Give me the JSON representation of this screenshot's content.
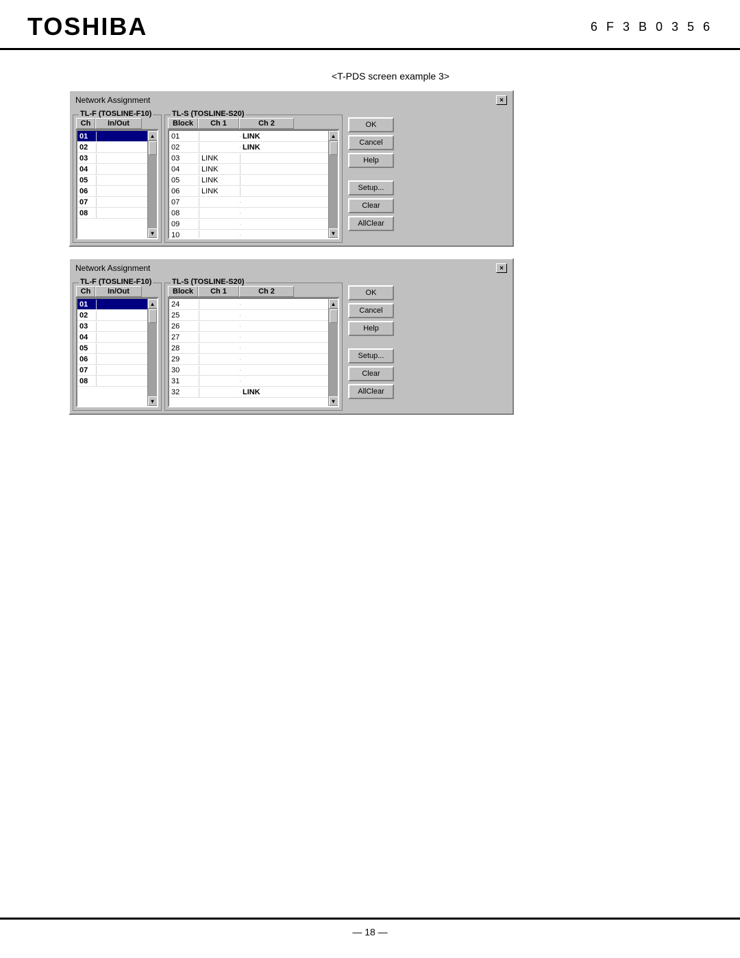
{
  "header": {
    "logo": "TOSHIBA",
    "doc_number": "6 F 3 B 0 3 5 6"
  },
  "screen_label": "<T-PDS screen example 3>",
  "dialog1": {
    "title": "Network Assignment",
    "close_label": "×",
    "tlf_group_label": "TL-F (TOSLINE-F10)",
    "tls_group_label": "TL-S (TOSLINE-S20)",
    "tlf_columns": [
      "Ch",
      "In/Out"
    ],
    "tls_columns": [
      "Block",
      "Ch 1",
      "Ch 2"
    ],
    "tlf_rows": [
      {
        "ch": "01",
        "inout": "",
        "selected": true
      },
      {
        "ch": "02",
        "inout": ""
      },
      {
        "ch": "03",
        "inout": ""
      },
      {
        "ch": "04",
        "inout": ""
      },
      {
        "ch": "05",
        "inout": ""
      },
      {
        "ch": "06",
        "inout": ""
      },
      {
        "ch": "07",
        "inout": ""
      },
      {
        "ch": "08",
        "inout": ""
      }
    ],
    "tls_rows": [
      {
        "block": "01",
        "ch1": "",
        "ch2": "LINK"
      },
      {
        "block": "02",
        "ch1": "",
        "ch2": "LINK"
      },
      {
        "block": "03",
        "ch1": "LINK",
        "ch2": ""
      },
      {
        "block": "04",
        "ch1": "LINK",
        "ch2": ""
      },
      {
        "block": "05",
        "ch1": "LINK",
        "ch2": ""
      },
      {
        "block": "06",
        "ch1": "LINK",
        "ch2": ""
      },
      {
        "block": "07",
        "ch1": "",
        "ch2": ""
      },
      {
        "block": "08",
        "ch1": "",
        "ch2": ""
      },
      {
        "block": "09",
        "ch1": "",
        "ch2": ""
      },
      {
        "block": "10",
        "ch1": "",
        "ch2": ""
      }
    ],
    "buttons": [
      {
        "label": "OK",
        "name": "ok-button"
      },
      {
        "label": "Cancel",
        "name": "cancel-button"
      },
      {
        "label": "Help",
        "name": "help-button"
      },
      {
        "label": "Setup...",
        "name": "setup-button"
      },
      {
        "label": "Clear",
        "name": "clear-button"
      },
      {
        "label": "AllClear",
        "name": "allclear-button"
      }
    ]
  },
  "dialog2": {
    "title": "Network Assignment",
    "close_label": "×",
    "tlf_group_label": "TL-F (TOSLINE-F10)",
    "tls_group_label": "TL-S (TOSLINE-S20)",
    "tlf_columns": [
      "Ch",
      "In/Out"
    ],
    "tls_columns": [
      "Block",
      "Ch 1",
      "Ch 2"
    ],
    "tlf_rows": [
      {
        "ch": "01",
        "inout": "",
        "selected": true
      },
      {
        "ch": "02",
        "inout": ""
      },
      {
        "ch": "03",
        "inout": ""
      },
      {
        "ch": "04",
        "inout": ""
      },
      {
        "ch": "05",
        "inout": ""
      },
      {
        "ch": "06",
        "inout": ""
      },
      {
        "ch": "07",
        "inout": ""
      },
      {
        "ch": "08",
        "inout": ""
      }
    ],
    "tls_rows": [
      {
        "block": "24",
        "ch1": "",
        "ch2": ""
      },
      {
        "block": "25",
        "ch1": "",
        "ch2": ""
      },
      {
        "block": "26",
        "ch1": "",
        "ch2": ""
      },
      {
        "block": "27",
        "ch1": "",
        "ch2": ""
      },
      {
        "block": "28",
        "ch1": "",
        "ch2": ""
      },
      {
        "block": "29",
        "ch1": "",
        "ch2": ""
      },
      {
        "block": "30",
        "ch1": "",
        "ch2": ""
      },
      {
        "block": "31",
        "ch1": "",
        "ch2": ""
      },
      {
        "block": "32",
        "ch1": "",
        "ch2": "LINK"
      }
    ],
    "buttons": [
      {
        "label": "OK",
        "name": "ok-button"
      },
      {
        "label": "Cancel",
        "name": "cancel-button"
      },
      {
        "label": "Help",
        "name": "help-button"
      },
      {
        "label": "Setup...",
        "name": "setup-button"
      },
      {
        "label": "Clear",
        "name": "clear-button"
      },
      {
        "label": "AllClear",
        "name": "allclear-button"
      }
    ]
  },
  "footer": {
    "page": "— 18 —"
  }
}
